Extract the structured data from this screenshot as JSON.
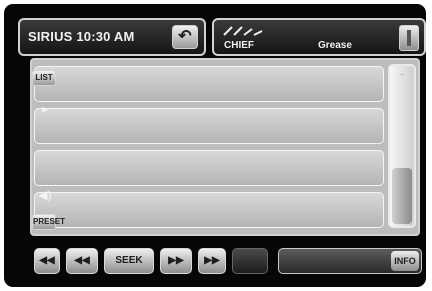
{
  "header": {
    "title": "SIRIUS 10:30 AM",
    "back_glyph": "↶",
    "artist": "CHIEF",
    "song": "Grease"
  },
  "sidebar": {
    "top_label": "LIST",
    "bottom_label": "PRESET",
    "play_glyph": "▸",
    "volume_glyph": "◀)"
  },
  "list": {
    "rows": [
      "",
      "",
      "",
      ""
    ]
  },
  "scroll": {
    "up_glyph": "⌃"
  },
  "transport": {
    "buttons": [
      "◀◀",
      "◀◀",
      "SEEK",
      "▶▶",
      "▶▶",
      ""
    ],
    "right_label": "INFO"
  },
  "colors": {
    "frame": "#060606",
    "panel": "#bdbdbd",
    "row": "#c6c6c6"
  },
  "icons": {
    "back": "back-arrow-icon",
    "trash": "trash-icon",
    "signal": "signal-strength-icon"
  }
}
